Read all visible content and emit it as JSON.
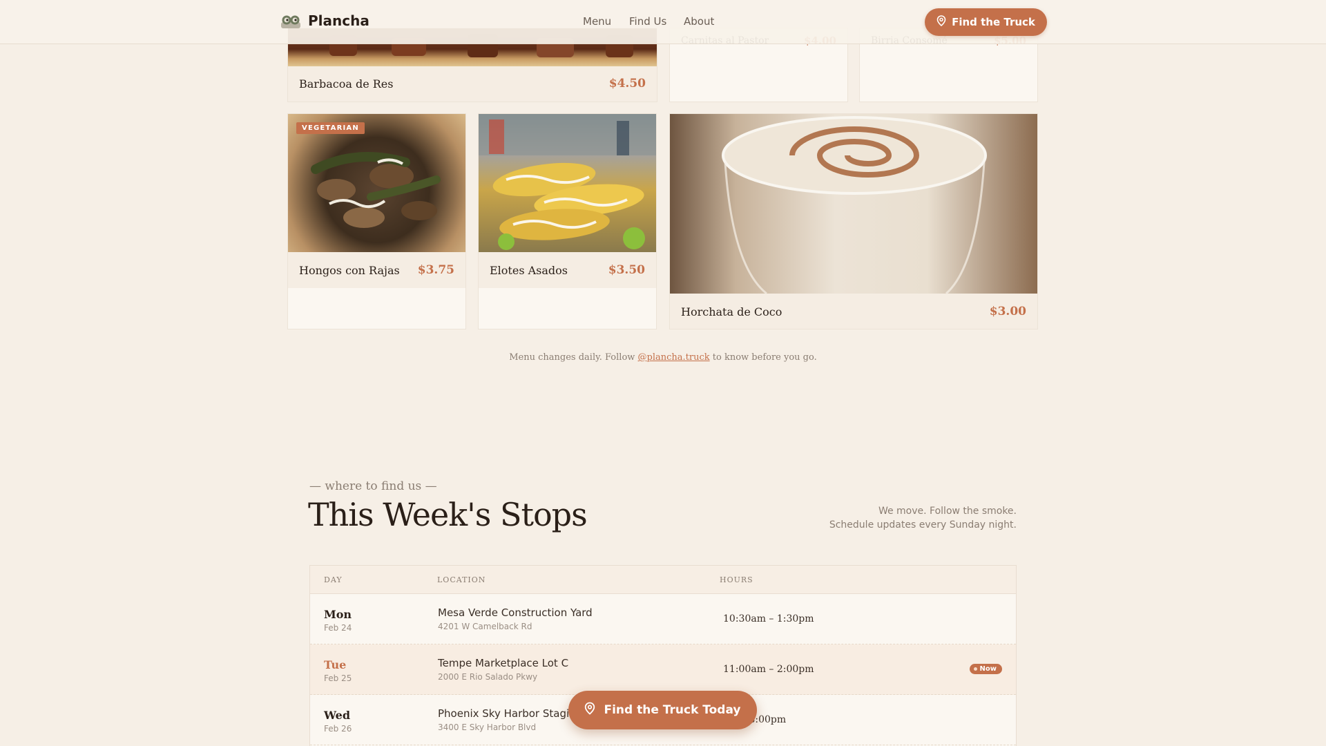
{
  "nav": {
    "brand": "Plancha",
    "links": [
      "Menu",
      "Find Us",
      "About"
    ],
    "cta": "Find the Truck"
  },
  "menu": {
    "items": [
      {
        "name": "Barbacoa de Res",
        "price": "$4.50"
      },
      {
        "name": "Carnitas al Pastor",
        "price": "$4.00"
      },
      {
        "name": "Birria Consomé",
        "price": "$5.00"
      },
      {
        "name": "Hongos con Rajas",
        "price": "$3.75",
        "tag": "VEGETARIAN"
      },
      {
        "name": "Elotes Asados",
        "price": "$3.50"
      },
      {
        "name": "Horchata de Coco",
        "price": "$3.00"
      }
    ],
    "note_prefix": "Menu changes daily. Follow ",
    "note_handle": "@plancha.truck",
    "note_suffix": " to know before you go."
  },
  "stops": {
    "eyebrow": "— where to find us —",
    "title": "This Week's Stops",
    "sub_line1": "We move. Follow the smoke.",
    "sub_line2": "Schedule updates every Sunday night.",
    "columns": [
      "DAY",
      "LOCATION",
      "HOURS"
    ],
    "rows": [
      {
        "day": "Mon",
        "date": "Feb 24",
        "location": "Mesa Verde Construction Yard",
        "address": "4201 W Camelback Rd",
        "hours": "10:30am – 1:30pm",
        "now": ""
      },
      {
        "day": "Tue",
        "date": "Feb 25",
        "location": "Tempe Marketplace Lot C",
        "address": "2000 E Rio Salado Pkwy",
        "hours": "11:00am – 2:00pm",
        "now": "Now"
      },
      {
        "day": "Wed",
        "date": "Feb 26",
        "location": "Phoenix Sky Harbor Staging",
        "address": "3400 E Sky Harbor Blvd",
        "hours": "– 3:00pm",
        "now": ""
      }
    ]
  },
  "float_cta": "Find the Truck Today",
  "colors": {
    "accent": "#c4704a",
    "background": "#f6efe6",
    "text": "#2a1f18"
  },
  "icons": {
    "logo": "eyes-logo-icon",
    "pin": "location-pin-icon"
  }
}
